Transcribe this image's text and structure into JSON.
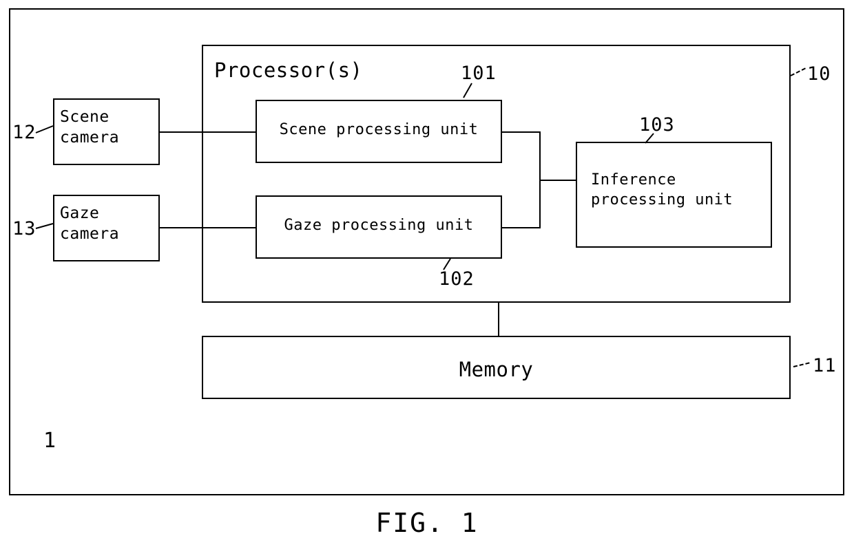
{
  "figure": {
    "caption": "FIG. 1",
    "system_ref": "1"
  },
  "processor": {
    "title": "Processor(s)",
    "ref": "10",
    "units": [
      {
        "label": "Scene processing unit",
        "ref": "101"
      },
      {
        "label": "Gaze processing unit",
        "ref": "102"
      },
      {
        "label": "Inference\nprocessing unit",
        "ref": "103"
      }
    ]
  },
  "memory": {
    "label": "Memory",
    "ref": "11"
  },
  "inputs": [
    {
      "label": "Scene\ncamera",
      "ref": "12"
    },
    {
      "label": "Gaze\ncamera",
      "ref": "13"
    }
  ],
  "connections": [
    {
      "from": "Scene camera",
      "to": "Scene processing unit"
    },
    {
      "from": "Gaze camera",
      "to": "Gaze processing unit"
    },
    {
      "from": "Scene processing unit",
      "to": "Inference processing unit"
    },
    {
      "from": "Gaze processing unit",
      "to": "Inference processing unit"
    },
    {
      "from": "Processor(s)",
      "to": "Memory"
    }
  ],
  "colors": {
    "ink": "#000000",
    "paper": "#ffffff"
  }
}
